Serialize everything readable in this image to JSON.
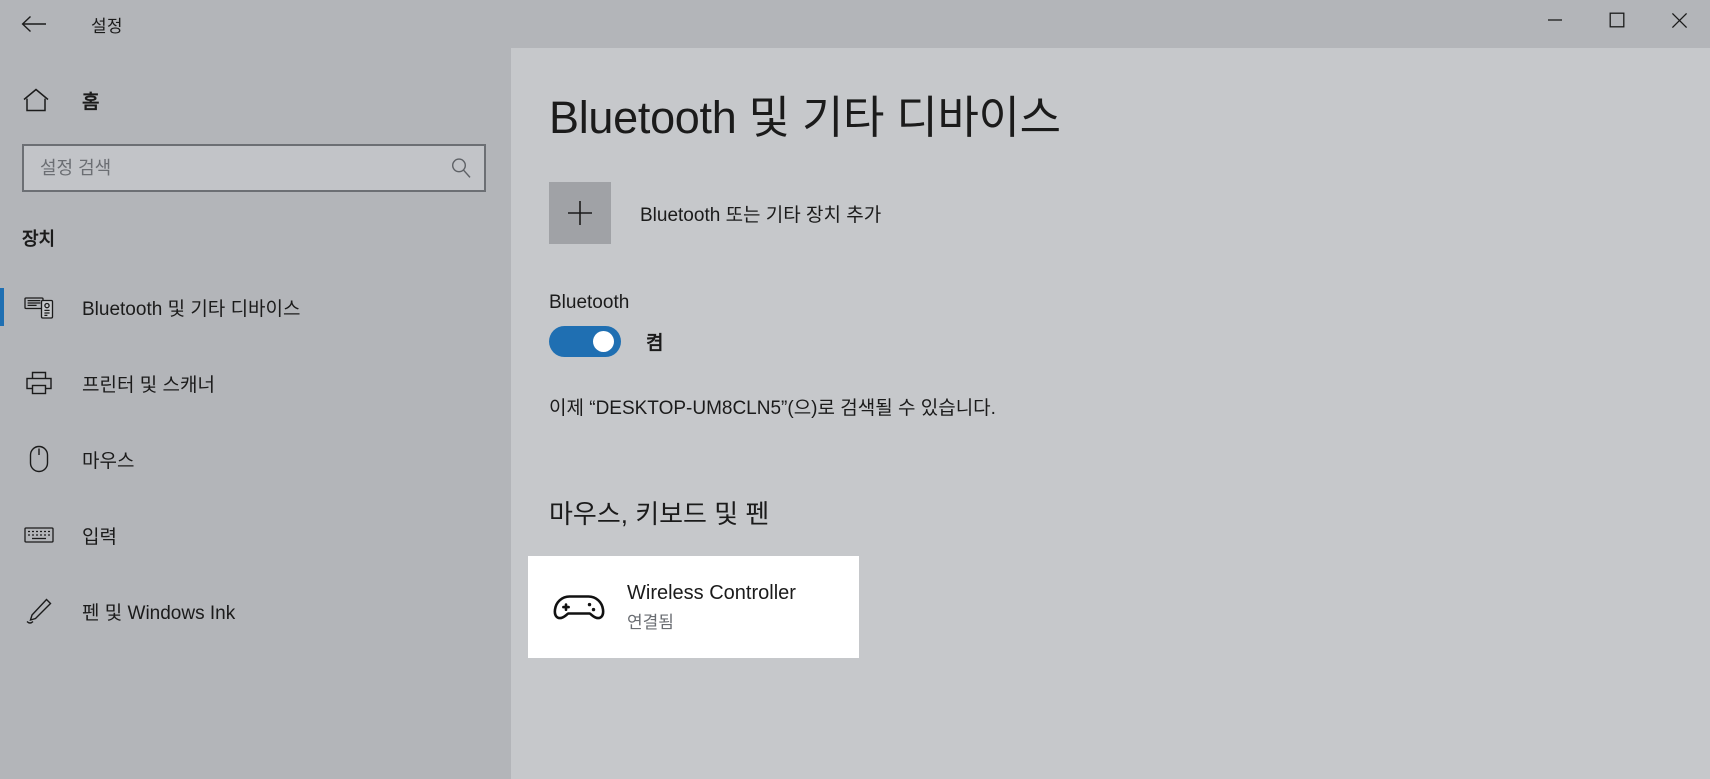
{
  "titlebar": {
    "back_icon": "back-arrow-icon",
    "title": "설정",
    "minimize_label": "minimize-icon",
    "maximize_label": "maximize-icon",
    "close_label": "close-icon"
  },
  "sidebar": {
    "home": {
      "label": "홈",
      "icon": "home-icon"
    },
    "search": {
      "placeholder": "설정 검색",
      "value": "",
      "icon": "search-icon"
    },
    "section_label": "장치",
    "items": [
      {
        "label": "Bluetooth 및 기타 디바이스",
        "icon": "bluetooth-devices-icon",
        "selected": true
      },
      {
        "label": "프린터 및 스캐너",
        "icon": "printer-icon",
        "selected": false
      },
      {
        "label": "마우스",
        "icon": "mouse-icon",
        "selected": false
      },
      {
        "label": "입력",
        "icon": "keyboard-icon",
        "selected": false
      },
      {
        "label": "펜 및 Windows Ink",
        "icon": "pen-icon",
        "selected": false
      }
    ]
  },
  "main": {
    "page_title": "Bluetooth 및 기타 디바이스",
    "add_device": {
      "label": "Bluetooth 또는 기타 장치 추가",
      "icon": "plus-icon"
    },
    "bluetooth": {
      "heading": "Bluetooth",
      "toggle_state": "켬",
      "toggle_on": true,
      "discoverable_text": "이제 “DESKTOP-UM8CLN5”(으)로 검색될 수 있습니다."
    },
    "group_heading": "마우스, 키보드 및 펜",
    "devices": [
      {
        "name": "Wireless Controller",
        "status": "연결됨",
        "icon": "gamepad-icon"
      }
    ]
  },
  "colors": {
    "accent": "#1f6fb2",
    "sidebar_bg": "#b3b5b9",
    "content_bg": "#c6c8cb",
    "tile_bg": "#a0a2a6",
    "card_bg": "#ffffff",
    "text": "#1b1b1b",
    "muted_text": "#6a6d72"
  }
}
